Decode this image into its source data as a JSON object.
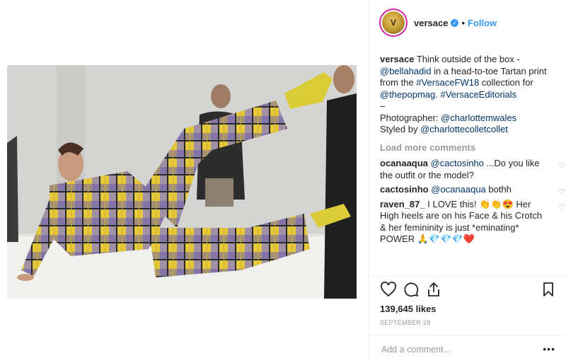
{
  "post": {
    "image_alt": "Model in head-to-toe tartan print reclining on a white platform",
    "author": {
      "username": "versace",
      "avatar_text": "V",
      "follow_label": "Follow",
      "separator": "•"
    },
    "caption": {
      "username": "versace",
      "text_1": "Think outside of the box -",
      "mention_1": "@bellahadid",
      "text_2": " in a head-to-toe Tartan print from the ",
      "hashtag_1": "#VersaceFW18",
      "text_3": " collection for ",
      "mention_2": "@thepopmag",
      "text_4": ". ",
      "hashtag_2": "#VersaceEditorials",
      "dash": "–",
      "photographer_label": "Photographer: ",
      "photographer": "@charlottemwales",
      "styled_label": "Styled by ",
      "stylist": "@charlottecolletcollet"
    },
    "load_more": "Load more comments",
    "comments": [
      {
        "username": "ocanaaqua",
        "mention": "@cactosinho",
        "text": " ...Do you like the outfit or the model?"
      },
      {
        "username": "cactosinho",
        "mention": "@ocanaaqua",
        "text": " bothh"
      },
      {
        "username": "raven_87_",
        "mention": "",
        "text": " I LOVE this! 👏👏😍 Her High heels are on his Face & his Crotch & her femininity is just *eminating* POWER 🙏💎💎💎❤️"
      }
    ],
    "likes": "139,645 likes",
    "date": "SEPTEMBER 28",
    "add_comment_placeholder": "Add a comment...",
    "more_label": "•••"
  },
  "icons": {
    "like": "heart-icon",
    "comment": "comment-icon",
    "share": "share-icon",
    "save": "bookmark-icon",
    "comment_like": "heart-icon"
  },
  "colors": {
    "link": "#003569",
    "follow": "#3897f0",
    "muted": "#999999"
  }
}
